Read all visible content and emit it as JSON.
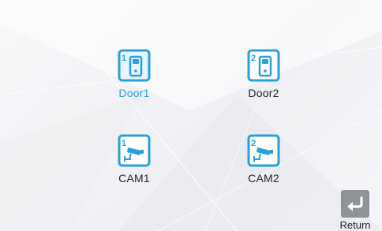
{
  "devices": {
    "door1": {
      "label": "Door1",
      "badge": "1",
      "icon": "door-station-icon",
      "selected": true
    },
    "door2": {
      "label": "Door2",
      "badge": "2",
      "icon": "door-station-icon",
      "selected": false
    },
    "cam1": {
      "label": "CAM1",
      "badge": "1",
      "icon": "cctv-camera-icon",
      "selected": false
    },
    "cam2": {
      "label": "CAM2",
      "badge": "2",
      "icon": "cctv-camera-icon",
      "selected": false
    }
  },
  "return_button": {
    "label": "Return",
    "icon": "return-arrow-icon"
  },
  "colors": {
    "accent": "#2aa0d8",
    "text": "#222222",
    "return_bg": "#8f9398"
  }
}
